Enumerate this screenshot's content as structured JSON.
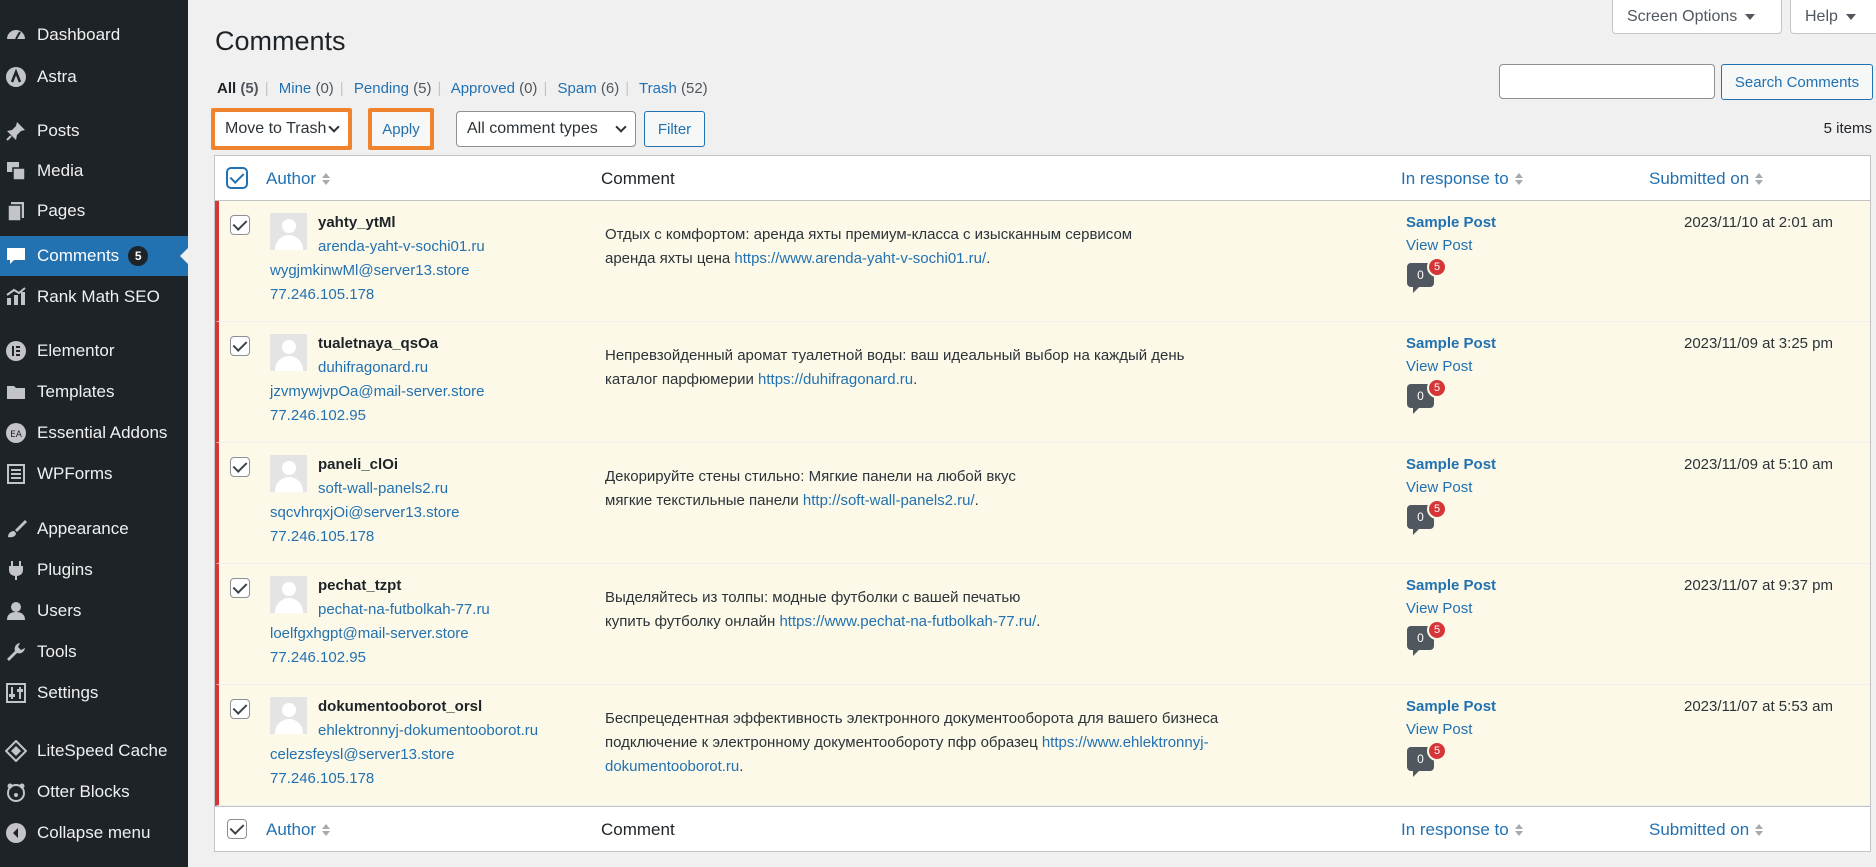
{
  "sidebar": {
    "items": [
      {
        "label": "Dashboard",
        "icon": "dashboard-icon"
      },
      {
        "label": "Astra",
        "icon": "astra-icon"
      },
      {
        "label": "Posts",
        "icon": "pushpin-icon"
      },
      {
        "label": "Media",
        "icon": "media-icon"
      },
      {
        "label": "Pages",
        "icon": "pages-icon"
      },
      {
        "label": "Comments",
        "icon": "comment-icon",
        "badge": "5"
      },
      {
        "label": "Rank Math SEO",
        "icon": "chart-icon"
      },
      {
        "label": "Elementor",
        "icon": "elementor-icon"
      },
      {
        "label": "Templates",
        "icon": "folder-icon"
      },
      {
        "label": "Essential Addons",
        "icon": "ea-icon"
      },
      {
        "label": "WPForms",
        "icon": "form-icon"
      },
      {
        "label": "Appearance",
        "icon": "brush-icon"
      },
      {
        "label": "Plugins",
        "icon": "plug-icon"
      },
      {
        "label": "Users",
        "icon": "user-icon"
      },
      {
        "label": "Tools",
        "icon": "wrench-icon"
      },
      {
        "label": "Settings",
        "icon": "settings-icon"
      },
      {
        "label": "LiteSpeed Cache",
        "icon": "diamond-icon"
      },
      {
        "label": "Otter Blocks",
        "icon": "otter-icon"
      },
      {
        "label": "Collapse menu",
        "icon": "collapse-icon"
      }
    ]
  },
  "topbar": {
    "screen_options": "Screen Options",
    "help": "Help"
  },
  "page": {
    "title": "Comments",
    "items_count": "5 items"
  },
  "filters": [
    {
      "label": "All",
      "count": "(5)"
    },
    {
      "label": "Mine",
      "count": "(0)"
    },
    {
      "label": "Pending",
      "count": "(5)"
    },
    {
      "label": "Approved",
      "count": "(0)"
    },
    {
      "label": "Spam",
      "count": "(6)"
    },
    {
      "label": "Trash",
      "count": "(52)"
    }
  ],
  "search": {
    "button": "Search Comments",
    "value": ""
  },
  "bulk": {
    "action": "Move to Trash",
    "apply": "Apply",
    "type": "All comment types",
    "filter": "Filter"
  },
  "columns": {
    "author": "Author",
    "comment": "Comment",
    "response": "In response to",
    "submitted": "Submitted on"
  },
  "accent": "#2271b1",
  "highlight_color": "#f0832d",
  "comments": [
    {
      "author": "yahty_ytMl",
      "url": "arenda-yaht-v-sochi01.ru",
      "email": "wygjmkinwMl@server13.store",
      "ip": "77.246.105.178",
      "text_line1": "Отдых с комфортом: аренда яхты премиум-класса с изысканным сервисом",
      "text_pre": "аренда яхты цена ",
      "text_link": "https://www.arenda-yaht-v-sochi01.ru/",
      "text_post": ".",
      "post": "Sample Post",
      "view": "View Post",
      "approved": "0",
      "pending": "5",
      "date": "2023/11/10 at 2:01 am"
    },
    {
      "author": "tualetnaya_qsOa",
      "url": "duhifragonard.ru",
      "email": "jzvmywjvpOa@mail-server.store",
      "ip": "77.246.102.95",
      "text_line1": "Непревзойденный аромат туалетной воды: ваш идеальный выбор на каждый день",
      "text_pre": "каталог парфюмерии ",
      "text_link": "https://duhifragonard.ru",
      "text_post": ".",
      "post": "Sample Post",
      "view": "View Post",
      "approved": "0",
      "pending": "5",
      "date": "2023/11/09 at 3:25 pm"
    },
    {
      "author": "paneli_clOi",
      "url": "soft-wall-panels2.ru",
      "email": "sqcvhrqxjOi@server13.store",
      "ip": "77.246.105.178",
      "text_line1": "Декорируйте стены стильно: Мягкие панели на любой вкус",
      "text_pre": "мягкие текстильные панели ",
      "text_link": "http://soft-wall-panels2.ru/",
      "text_post": ".",
      "post": "Sample Post",
      "view": "View Post",
      "approved": "0",
      "pending": "5",
      "date": "2023/11/09 at 5:10 am"
    },
    {
      "author": "pechat_tzpt",
      "url": "pechat-na-futbolkah-77.ru",
      "email": "loelfgxhgpt@mail-server.store",
      "ip": "77.246.102.95",
      "text_line1": "Выделяйтесь из толпы: модные футболки с вашей печатью",
      "text_pre": "купить футболку онлайн ",
      "text_link": "https://www.pechat-na-futbolkah-77.ru/",
      "text_post": ".",
      "post": "Sample Post",
      "view": "View Post",
      "approved": "0",
      "pending": "5",
      "date": "2023/11/07 at 9:37 pm"
    },
    {
      "author": "dokumentooborot_orsl",
      "url": "ehlektronnyj-dokumentooborot.ru",
      "email": "celezsfeysl@server13.store",
      "ip": "77.246.105.178",
      "text_line1": "Беспрецедентная эффективность электронного документооборота для вашего бизнеса",
      "text_pre": "подключение к электронному документообороту пфр образец ",
      "text_link": "https://www.ehlektronnyj-dokumentooborot.ru",
      "text_post": ".",
      "post": "Sample Post",
      "view": "View Post",
      "approved": "0",
      "pending": "5",
      "date": "2023/11/07 at 5:53 am"
    }
  ]
}
